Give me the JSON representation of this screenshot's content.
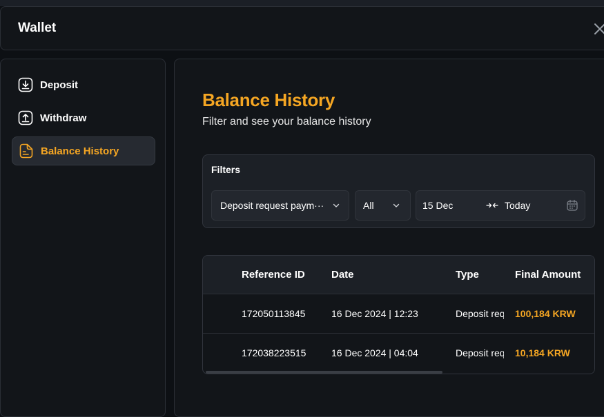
{
  "header": {
    "title": "Wallet"
  },
  "sidebar": {
    "items": [
      {
        "label": "Deposit",
        "icon": "deposit-icon",
        "active": false
      },
      {
        "label": "Withdraw",
        "icon": "withdraw-icon",
        "active": false
      },
      {
        "label": "Balance History",
        "icon": "document-icon",
        "active": true
      }
    ]
  },
  "main": {
    "title": "Balance History",
    "subtitle": "Filter and see your balance history",
    "filters": {
      "title": "Filters",
      "type_select": "Deposit request paym···",
      "status_select": "All",
      "date_from": "15 Dec",
      "date_to": "Today"
    },
    "table": {
      "columns": [
        "Reference ID",
        "Date",
        "Type",
        "Final Amount"
      ],
      "rows": [
        {
          "reference_id": "172050113845",
          "date": "16 Dec 2024 | 12:23",
          "type": "Deposit request",
          "final_amount": "100,184 KRW"
        },
        {
          "reference_id": "172038223515",
          "date": "16 Dec 2024 | 04:04",
          "type": "Deposit request",
          "final_amount": "10,184 KRW"
        }
      ]
    }
  },
  "colors": {
    "accent": "#f5a623",
    "background": "#0d1014",
    "panel": "#121519"
  }
}
